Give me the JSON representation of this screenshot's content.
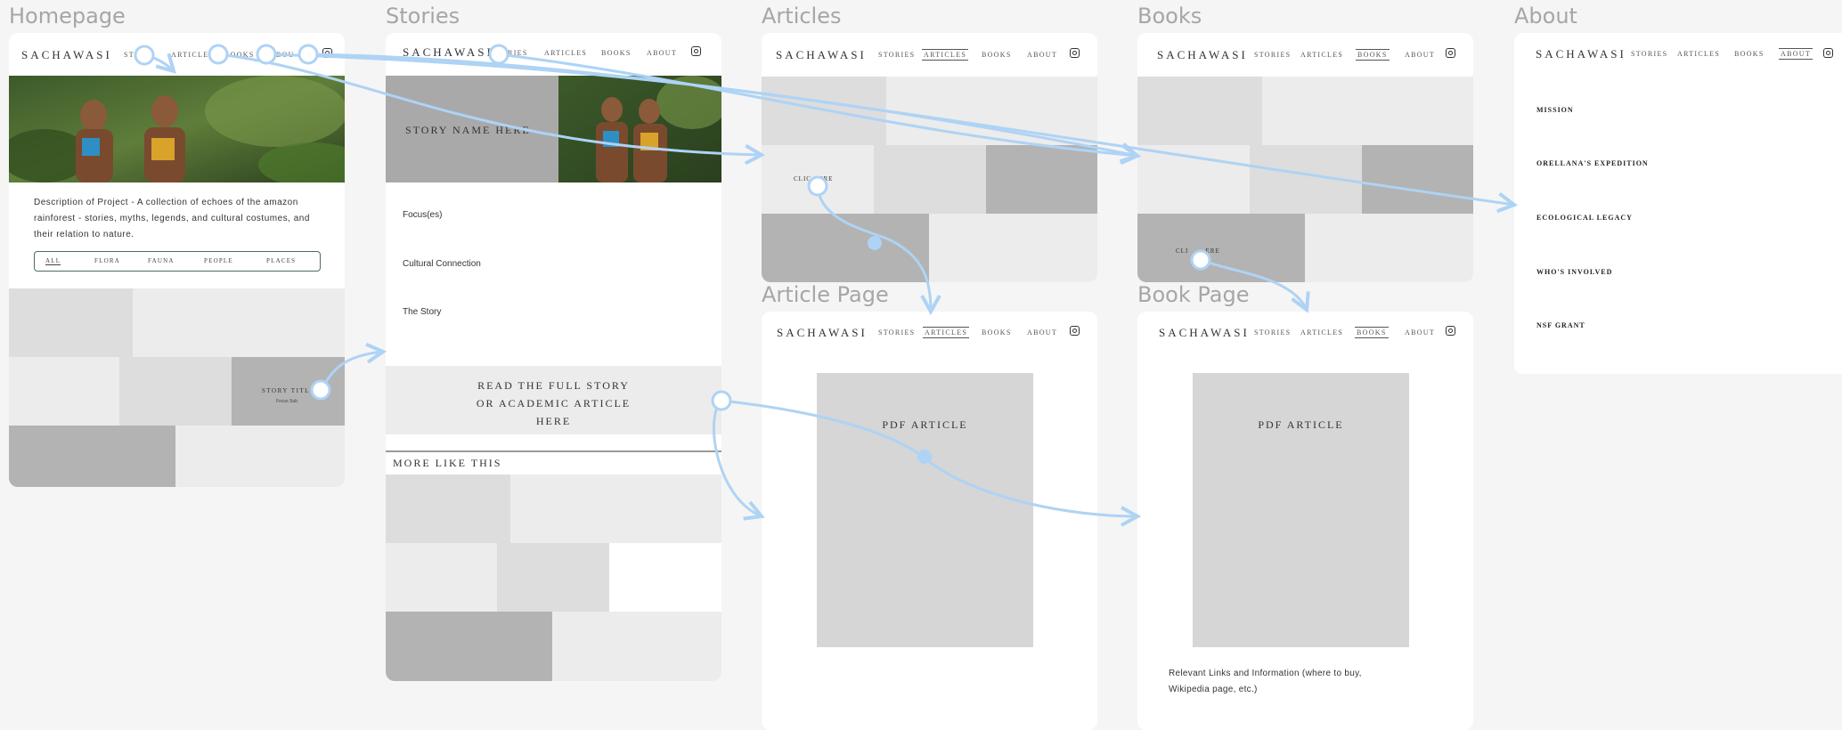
{
  "frames": {
    "homepage": "Homepage",
    "stories": "Stories",
    "articles": "Articles",
    "books": "Books",
    "about": "About",
    "article_page": "Article Page",
    "book_page": "Book Page"
  },
  "nav": {
    "logo": "SACHAWASI",
    "stories": "STORIES",
    "articles": "ARTICLES",
    "books": "BOOKS",
    "about": "ABOUT",
    "home_stories": "ST",
    "home_articles": "ARTICLES",
    "home_books": "BOOKS",
    "home_about": "BOU",
    "stories_logo": "SACHAWASI",
    "stories_link": "ORIES"
  },
  "homepage": {
    "description": "Description of Project - A collection of echoes of the amazon rainforest - stories, myths, legends, and cultural costumes, and their relation to nature.",
    "filters": [
      "ALL",
      "FLORA",
      "FAUNA",
      "PEOPLE",
      "PLACES"
    ],
    "story_title": "STORY TITL",
    "story_sub": "Focus Sub"
  },
  "stories": {
    "story_name": "STORY NAME HERE",
    "focus": "Focus(es)",
    "cultural": "Cultural Connection",
    "story": "The Story",
    "read_line1": "READ THE FULL STORY",
    "read_line2": "OR ACADEMIC ARTICLE",
    "read_line3": "HERE",
    "more": "MORE LIKE THIS"
  },
  "articles": {
    "click_here": "CLIC   ERE"
  },
  "books": {
    "click_here": "CLI       ERE"
  },
  "about": {
    "items": [
      "MISSION",
      "ORELLANA'S EXPEDITION",
      "ECOLOGICAL LEGACY",
      "WHO'S INVOLVED",
      "NSF GRANT"
    ]
  },
  "article_page": {
    "pdf": "PDF ARTICLE"
  },
  "book_page": {
    "pdf": "PDF ARTICLE",
    "links_line1": "Relevant Links and Information (where to buy,",
    "links_line2": "Wikipedia page, etc.)"
  },
  "colors": {
    "flow": "#aed3f5",
    "filter_border": "#4f6d5a"
  }
}
